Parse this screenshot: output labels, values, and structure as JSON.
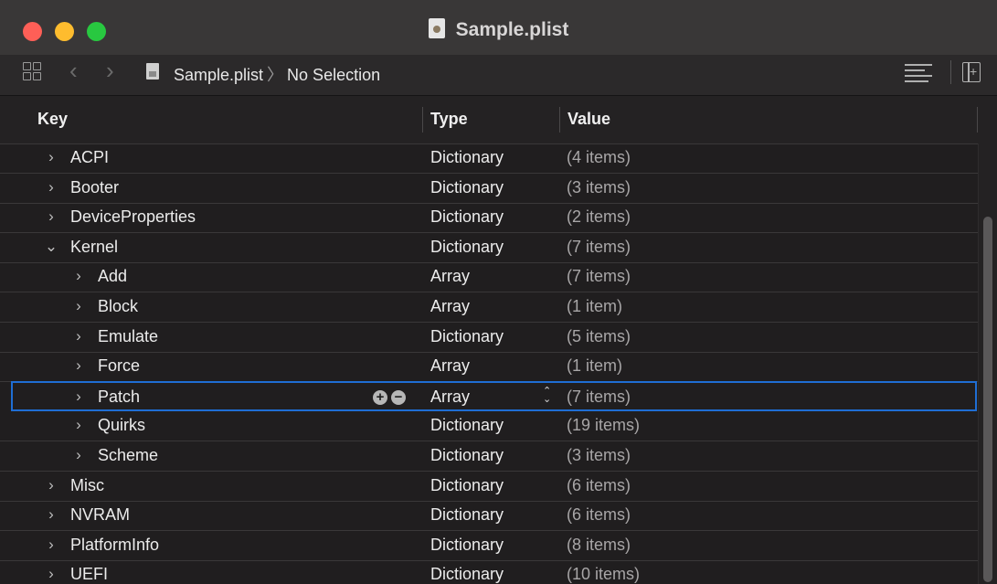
{
  "window": {
    "title": "Sample.plist"
  },
  "toolbar": {
    "breadcrumb_file": "Sample.plist",
    "breadcrumb_separator": "〉",
    "breadcrumb_selection": "No Selection"
  },
  "columns": {
    "key": "Key",
    "type": "Type",
    "value": "Value"
  },
  "rows": [
    {
      "key": "ACPI",
      "type": "Dictionary",
      "value": "(4 items)",
      "expanded": false,
      "level": 0
    },
    {
      "key": "Booter",
      "type": "Dictionary",
      "value": "(3 items)",
      "expanded": false,
      "level": 0
    },
    {
      "key": "DeviceProperties",
      "type": "Dictionary",
      "value": "(2 items)",
      "expanded": false,
      "level": 0
    },
    {
      "key": "Kernel",
      "type": "Dictionary",
      "value": "(7 items)",
      "expanded": true,
      "level": 0
    },
    {
      "key": "Add",
      "type": "Array",
      "value": "(7 items)",
      "expanded": false,
      "level": 1
    },
    {
      "key": "Block",
      "type": "Array",
      "value": "(1 item)",
      "expanded": false,
      "level": 1
    },
    {
      "key": "Emulate",
      "type": "Dictionary",
      "value": "(5 items)",
      "expanded": false,
      "level": 1
    },
    {
      "key": "Force",
      "type": "Array",
      "value": "(1 item)",
      "expanded": false,
      "level": 1
    },
    {
      "key": "Patch",
      "type": "Array",
      "value": "(7 items)",
      "expanded": false,
      "level": 1,
      "selected": true
    },
    {
      "key": "Quirks",
      "type": "Dictionary",
      "value": "(19 items)",
      "expanded": false,
      "level": 1
    },
    {
      "key": "Scheme",
      "type": "Dictionary",
      "value": "(3 items)",
      "expanded": false,
      "level": 1
    },
    {
      "key": "Misc",
      "type": "Dictionary",
      "value": "(6 items)",
      "expanded": false,
      "level": 0
    },
    {
      "key": "NVRAM",
      "type": "Dictionary",
      "value": "(6 items)",
      "expanded": false,
      "level": 0
    },
    {
      "key": "PlatformInfo",
      "type": "Dictionary",
      "value": "(8 items)",
      "expanded": false,
      "level": 0
    },
    {
      "key": "UEFI",
      "type": "Dictionary",
      "value": "(10 items)",
      "expanded": false,
      "level": 0
    }
  ],
  "icons": {
    "collapsed": "›",
    "expanded": "⌄",
    "add": "+",
    "remove": "−",
    "stepper": "⌃⌄"
  },
  "colors": {
    "selection_border": "#1f6ed4",
    "close": "#fe5f57",
    "minimize": "#febc2e",
    "maximize": "#28c840"
  }
}
